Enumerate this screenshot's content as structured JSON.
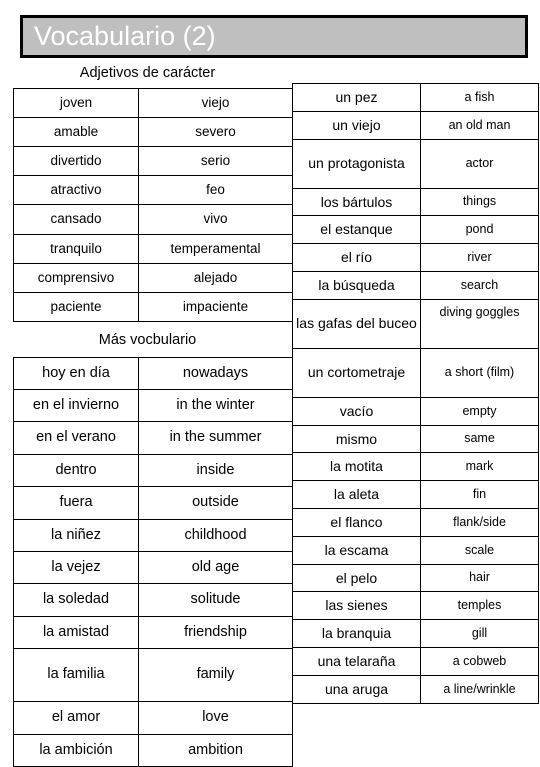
{
  "slide": {
    "title": "Vocabulario (2)",
    "title_bar_fill": "#bfbfbf",
    "title_text_color": "#ffffff",
    "border_color": "#000000",
    "background": "#ffffff"
  },
  "left_column": {
    "section1": {
      "heading": "Adjetivos de carácter",
      "rows": [
        {
          "spanish": "joven",
          "english": "viejo"
        },
        {
          "spanish": "amable",
          "english": "severo"
        },
        {
          "spanish": "divertido",
          "english": "serio"
        },
        {
          "spanish": "atractivo",
          "english": "feo"
        },
        {
          "spanish": "cansado",
          "english": "vivo"
        },
        {
          "spanish": "tranquilo",
          "english": "temperamental"
        },
        {
          "spanish": "comprensivo",
          "english": "alejado"
        },
        {
          "spanish": "paciente",
          "english": "impaciente"
        }
      ]
    },
    "section2": {
      "heading": "Más vocbulario",
      "rows": [
        {
          "spanish": "hoy en día",
          "english": "nowadays"
        },
        {
          "spanish": "en el invierno",
          "english": "in the winter"
        },
        {
          "spanish": "en el verano",
          "english": "in the summer"
        },
        {
          "spanish": "dentro",
          "english": "inside"
        },
        {
          "spanish": "fuera",
          "english": "outside"
        },
        {
          "spanish": "la niñez",
          "english": "childhood"
        },
        {
          "spanish": "la vejez",
          "english": "old age"
        },
        {
          "spanish": "la soledad",
          "english": "solitude"
        },
        {
          "spanish": "la amistad",
          "english": "friendship"
        },
        {
          "spanish": "la familia",
          "english": "family"
        },
        {
          "spanish": "el amor",
          "english": "love"
        },
        {
          "spanish": "la ambición",
          "english": "ambition"
        }
      ]
    }
  },
  "right_column": {
    "rows": [
      {
        "spanish": "un pez",
        "english": "a fish"
      },
      {
        "spanish": "un viejo",
        "english": "an old man"
      },
      {
        "spanish": "un protagonista",
        "english": "actor"
      },
      {
        "spanish": "los bártulos",
        "english": "things"
      },
      {
        "spanish": "el estanque",
        "english": "pond"
      },
      {
        "spanish": "el río",
        "english": "river"
      },
      {
        "spanish": "la búsqueda",
        "english": "search"
      },
      {
        "spanish": "las gafas del buceo",
        "english": "diving goggles"
      },
      {
        "spanish": "un cortometraje",
        "english": "a short (film)"
      },
      {
        "spanish": "vacío",
        "english": "empty"
      },
      {
        "spanish": "mismo",
        "english": "same"
      },
      {
        "spanish": "la motita",
        "english": "mark"
      },
      {
        "spanish": "la aleta",
        "english": "fin"
      },
      {
        "spanish": "el flanco",
        "english": "flank/side"
      },
      {
        "spanish": "la escama",
        "english": "scale"
      },
      {
        "spanish": "el pelo",
        "english": "hair"
      },
      {
        "spanish": "las sienes",
        "english": "temples"
      },
      {
        "spanish": "la branquia",
        "english": "gill"
      },
      {
        "spanish": "una telaraña",
        "english": "a cobweb"
      },
      {
        "spanish": "una aruga",
        "english": "a line/wrinkle"
      }
    ]
  }
}
